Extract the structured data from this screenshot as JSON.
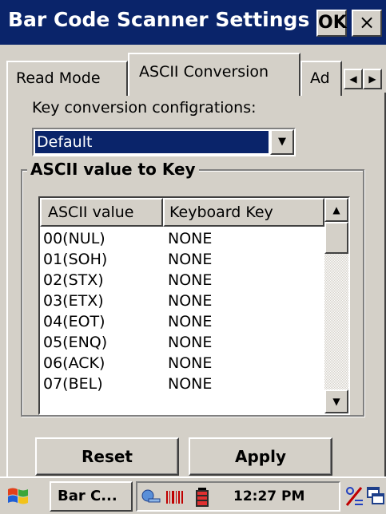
{
  "window": {
    "title": "Bar Code Scanner Settings",
    "ok_label": "OK",
    "close_label": "×"
  },
  "tabs": [
    {
      "label": "Read Mode",
      "active": false
    },
    {
      "label": "ASCII Conversion",
      "active": true
    },
    {
      "label": "Ad",
      "active": false
    }
  ],
  "tab_scroll": {
    "left": "◀",
    "right": "▶"
  },
  "conversion": {
    "label": "Key conversion configrations:",
    "selected": "Default",
    "dropdown_glyph": "▼"
  },
  "group": {
    "title": "ASCII value to Key"
  },
  "table": {
    "columns": [
      "ASCII value",
      "Keyboard Key"
    ],
    "rows": [
      [
        "00(NUL)",
        "NONE"
      ],
      [
        "01(SOH)",
        "NONE"
      ],
      [
        "02(STX)",
        "NONE"
      ],
      [
        "03(ETX)",
        "NONE"
      ],
      [
        "04(EOT)",
        "NONE"
      ],
      [
        "05(ENQ)",
        "NONE"
      ],
      [
        "06(ACK)",
        "NONE"
      ],
      [
        "07(BEL)",
        "NONE"
      ]
    ],
    "scroll_up": "▲",
    "scroll_down": "▼"
  },
  "buttons": {
    "reset": "Reset",
    "apply": "Apply"
  },
  "taskbar": {
    "task_label": "Bar C...",
    "clock": "12:27 PM"
  },
  "colors": {
    "titlebar": "#0a246a",
    "selection": "#0a246a",
    "face": "#d4d0c8"
  }
}
